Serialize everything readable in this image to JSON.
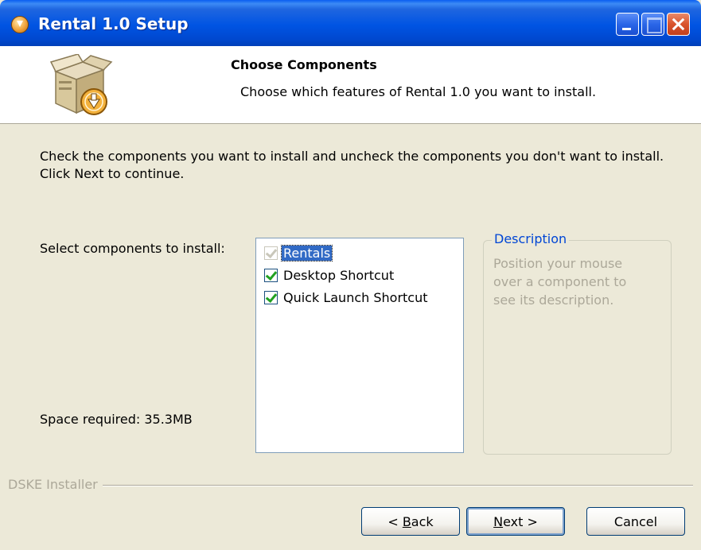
{
  "window": {
    "title": "Rental 1.0 Setup"
  },
  "header": {
    "heading": "Choose Components",
    "subheading": "Choose which features of Rental 1.0 you want to install."
  },
  "body": {
    "intro": "Check the components you want to install and uncheck the components you don't want to install. Click Next to continue.",
    "select_label": "Select components to install:",
    "space_required": "Space required: 35.3MB"
  },
  "components": [
    {
      "label": "Rentals",
      "checked": true,
      "disabled": true,
      "selected": true
    },
    {
      "label": "Desktop Shortcut",
      "checked": true,
      "disabled": false,
      "selected": false
    },
    {
      "label": "Quick Launch Shortcut",
      "checked": true,
      "disabled": false,
      "selected": false
    }
  ],
  "description": {
    "title": "Description",
    "text": "Position your mouse over a component to see its description."
  },
  "branding": "DSKE Installer",
  "buttons": {
    "back": {
      "prefix": "< ",
      "accel": "B",
      "rest": "ack"
    },
    "next": {
      "accel": "N",
      "rest": "ext >"
    },
    "cancel": "Cancel"
  },
  "colors": {
    "titlebar": "#0054e3",
    "dialog_bg": "#ece9d8",
    "selection": "#316ac5",
    "description_title": "#0046d5",
    "checkmark": "#21a121"
  },
  "icons": {
    "title": "installer-icon",
    "header": "package-install-icon",
    "minimize": "minimize-icon",
    "maximize": "maximize-icon",
    "close": "close-icon",
    "checkbox": "checkbox-icon"
  }
}
